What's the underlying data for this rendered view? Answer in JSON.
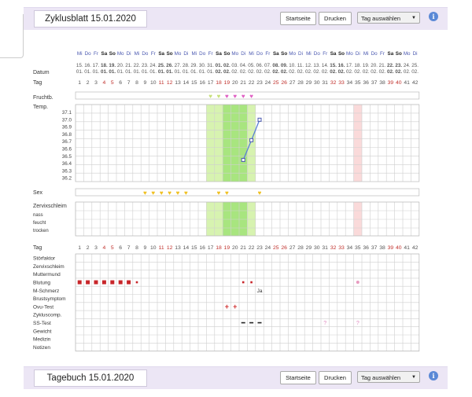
{
  "cycle_panel": {
    "title": "Zyklusblatt 15.01.2020",
    "btn_home": "Startseite",
    "btn_print": "Drucken",
    "day_select": "Tag auswählen",
    "info": "i"
  },
  "diary_panel": {
    "title": "Tagebuch 15.01.2020",
    "btn_home": "Startseite",
    "btn_print": "Drucken",
    "day_select": "Tag auswählen",
    "info": "i"
  },
  "labels": {
    "datum": "Datum",
    "tag": "Tag",
    "frucht": "Fruchtb.",
    "temp": "Temp.",
    "sex": "Sex",
    "zervix": "Zervixschleim",
    "nass": "nass",
    "feucht": "feucht",
    "trocken": "trocken",
    "tag2": "Tag",
    "rows": [
      "Störfaktor",
      "Zervixschleim",
      "Muttermund",
      "Blutung",
      "M-Schmerz",
      "Brustsymptom",
      "Ovu-Test",
      "Zykluscomp.",
      "SS-Test",
      "Gewicht",
      "Medizin",
      "Notizen"
    ]
  },
  "weekdays": [
    "Mi",
    "Do",
    "Fr",
    "Sa",
    "So",
    "Mo",
    "Di",
    "Mi",
    "Do",
    "Fr",
    "Sa",
    "So",
    "Mo",
    "Di",
    "Mi",
    "Do",
    "Fr",
    "Sa",
    "So",
    "Mo",
    "Di",
    "Mi",
    "Do",
    "Fr",
    "Sa",
    "So",
    "Mo",
    "Di",
    "Mi",
    "Do",
    "Fr",
    "Sa",
    "So",
    "Mo",
    "Di",
    "Mi",
    "Do",
    "Fr",
    "Sa",
    "So",
    "Mo",
    "Di"
  ],
  "dates_day": [
    "15.",
    "16.",
    "17.",
    "18.",
    "19.",
    "20.",
    "21.",
    "22.",
    "23.",
    "24.",
    "25.",
    "26.",
    "27.",
    "28.",
    "29.",
    "30.",
    "31.",
    "01.",
    "02.",
    "03.",
    "04.",
    "05.",
    "06.",
    "07.",
    "08.",
    "09.",
    "10.",
    "11.",
    "12.",
    "13.",
    "14.",
    "15.",
    "16.",
    "17.",
    "18.",
    "19.",
    "20.",
    "21.",
    "22.",
    "23.",
    "24.",
    "25."
  ],
  "dates_month": [
    "01.",
    "01.",
    "01.",
    "01.",
    "01.",
    "01.",
    "01.",
    "01.",
    "01.",
    "01.",
    "01.",
    "01.",
    "01.",
    "01.",
    "01.",
    "01.",
    "01.",
    "02.",
    "02.",
    "02.",
    "02.",
    "02.",
    "02.",
    "02.",
    "02.",
    "02.",
    "02.",
    "02.",
    "02.",
    "02.",
    "02.",
    "02.",
    "02.",
    "02.",
    "02.",
    "02.",
    "02.",
    "02.",
    "02.",
    "02.",
    "02.",
    "02."
  ],
  "weekend_days": [
    4,
    5,
    11,
    12,
    18,
    19,
    25,
    26,
    32,
    33,
    39,
    40
  ],
  "temp_axis": [
    "37.1",
    "37.0",
    "36.9",
    "36.8",
    "36.7",
    "36.6",
    "36.5",
    "36.4",
    "36.3",
    "36.2"
  ],
  "chart_data": {
    "type": "line",
    "x": [
      21,
      22,
      23
    ],
    "values": [
      36.45,
      36.72,
      37.0
    ],
    "ylim": [
      36.2,
      37.1
    ]
  },
  "fertile_window": {
    "light_days": [
      17,
      18,
      22
    ],
    "dark_days": [
      19,
      20,
      21
    ]
  },
  "next_period_day": 35,
  "fruchtbarkeit_hearts": [
    {
      "day": 17,
      "color": "#c7e07a"
    },
    {
      "day": 18,
      "color": "#c7e07a"
    },
    {
      "day": 19,
      "color": "#e05fc3"
    },
    {
      "day": 20,
      "color": "#e05fc3"
    },
    {
      "day": 21,
      "color": "#e05fc3"
    },
    {
      "day": 22,
      "color": "#e05fc3"
    }
  ],
  "sex_days": [
    9,
    10,
    11,
    12,
    13,
    14,
    18,
    19,
    23
  ],
  "blutung_days": [
    {
      "day": 1,
      "size": "big"
    },
    {
      "day": 2,
      "size": "big"
    },
    {
      "day": 3,
      "size": "big"
    },
    {
      "day": 4,
      "size": "big"
    },
    {
      "day": 5,
      "size": "big"
    },
    {
      "day": 6,
      "size": "big"
    },
    {
      "day": 7,
      "size": "big"
    },
    {
      "day": 8,
      "size": "small"
    },
    {
      "day": 21,
      "size": "small"
    },
    {
      "day": 22,
      "size": "small"
    }
  ],
  "blutung_pink_day": 35,
  "m_schmerz": {
    "day": 23,
    "text": "Ja"
  },
  "ovu_test_days": [
    19,
    20
  ],
  "ss_test_dashes": [
    21,
    22,
    23
  ],
  "ss_test_question_days": [
    31,
    35
  ],
  "ss_test_question": "?"
}
